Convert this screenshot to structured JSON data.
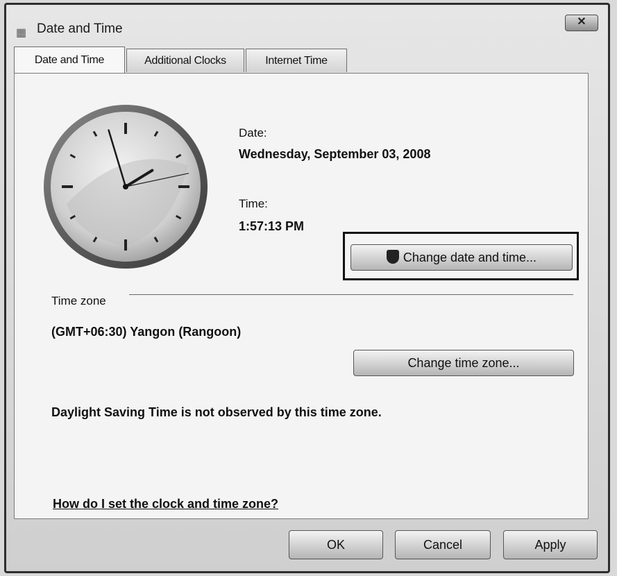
{
  "window": {
    "title": "Date and Time",
    "close_symbol": "✕",
    "icon": "calendar-icon"
  },
  "tabs": [
    {
      "label": "Date and Time",
      "active": true
    },
    {
      "label": "Additional Clocks",
      "active": false
    },
    {
      "label": "Internet Time",
      "active": false
    }
  ],
  "date": {
    "label": "Date:",
    "value": "Wednesday, September 03, 2008"
  },
  "time": {
    "label": "Time:",
    "value": "1:57:13 PM"
  },
  "clock": {
    "hour": 1,
    "minute": 57,
    "second": 13
  },
  "change_datetime_button": {
    "label": "Change date and time...",
    "icon": "shield-icon"
  },
  "time_zone": {
    "group_label": "Time zone",
    "value": "(GMT+06:30) Yangon (Rangoon)",
    "change_button": "Change time zone...",
    "dst_note": "Daylight Saving Time is not observed by this time zone."
  },
  "help_link": "How do I set the clock and time zone?",
  "footer": {
    "ok": "OK",
    "cancel": "Cancel",
    "apply": "Apply"
  }
}
